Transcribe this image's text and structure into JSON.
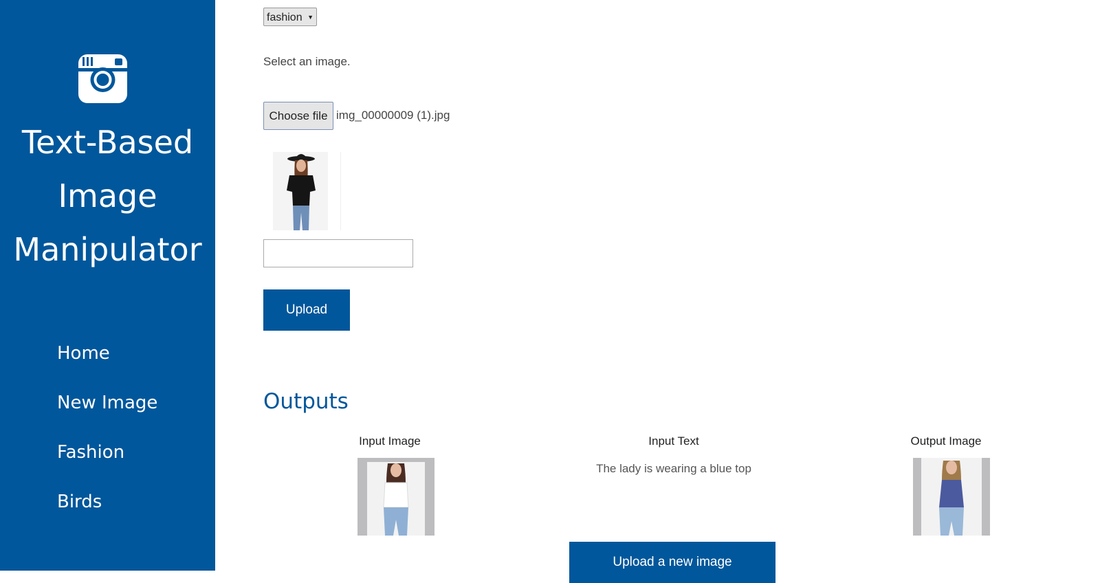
{
  "sidebar": {
    "logo_icon": "camera-icon",
    "title_lines": [
      "Text-Based",
      "Image",
      "Manipulator"
    ],
    "nav": [
      {
        "label": "Home"
      },
      {
        "label": "New Image"
      },
      {
        "label": "Fashion"
      },
      {
        "label": "Birds"
      }
    ]
  },
  "form": {
    "category_select": {
      "selected": "fashion"
    },
    "instruction": "Select an image.",
    "file_button_label": "Choose file",
    "file_name": "img_00000009 (1).jpg",
    "text_input_value": "",
    "upload_label": "Upload"
  },
  "outputs": {
    "heading": "Outputs",
    "columns": {
      "input_image": "Input Image",
      "input_text": "Input Text",
      "output_image": "Output Image"
    },
    "input_text_value": "The lady is wearing a blue top",
    "new_image_button_label": "Upload a new image"
  },
  "colors": {
    "brand": "#01579b",
    "background": "#ffffff"
  }
}
